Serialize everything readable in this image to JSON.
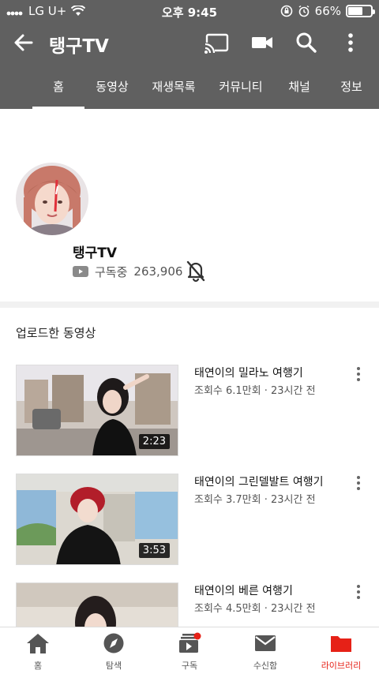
{
  "status_bar": {
    "carrier": "LG U+",
    "time": "오후 9:45",
    "battery": "66%",
    "battery_level": 0.66
  },
  "app_bar": {
    "channel_title": "탱구TV",
    "icons": [
      "back-arrow-icon",
      "cast-icon",
      "video-camera-icon",
      "search-icon",
      "more-vert-icon"
    ]
  },
  "tabs": [
    {
      "label": "홈",
      "active": true
    },
    {
      "label": "동영상"
    },
    {
      "label": "재생목록"
    },
    {
      "label": "커뮤니티"
    },
    {
      "label": "채널"
    },
    {
      "label": "정보"
    }
  ],
  "channel": {
    "name": "탱구TV",
    "subscribed_label": "구독중",
    "subscriber_count": "263,906"
  },
  "uploads": {
    "section_title": "업로드한 동영상",
    "videos": [
      {
        "title": "태연이의 밀라노 여행기",
        "meta": "조회수 6.1만회 · 23시간 전",
        "duration": "2:23"
      },
      {
        "title": "태연이의 그린델발트 여행기",
        "meta": "조회수 3.7만회 · 23시간 전",
        "duration": "3:53"
      },
      {
        "title": "태연이의 베른 여행기",
        "meta": "조회수 4.5만회 · 23시간 전",
        "duration": ""
      }
    ]
  },
  "bottom_nav": [
    {
      "label": "홈",
      "icon": "home-icon"
    },
    {
      "label": "탐색",
      "icon": "compass-icon"
    },
    {
      "label": "구독",
      "icon": "subscriptions-icon"
    },
    {
      "label": "수신함",
      "icon": "inbox-icon"
    },
    {
      "label": "라이브러리",
      "icon": "library-icon",
      "active": true
    }
  ],
  "colors": {
    "header_gray": "#606060",
    "accent_red": "#e62117",
    "text_primary": "#111111",
    "text_secondary": "#555555"
  }
}
